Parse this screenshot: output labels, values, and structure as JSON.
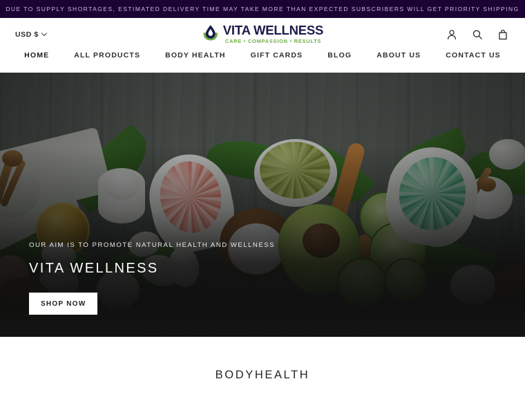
{
  "announcement": {
    "text": "DUE TO SUPPLY SHORTAGES, ESTIMATED DELIVERY TIME MAY TAKE MORE THAN EXPECTED SUBSCRIBERS WILL GET PRIORITY SHIPPING",
    "background_color": "#1b0434",
    "text_color": "#cdb8de"
  },
  "header": {
    "currency": {
      "label": "USD $",
      "options": [
        "USD $"
      ]
    },
    "logo": {
      "name": "VITA WELLNESS",
      "tagline": "CARE • COMPASSION • RESULTS",
      "name_color": "#1b1b4b",
      "tagline_color": "#6fae45",
      "mark": "water-drop-leaf-icon"
    },
    "actions": [
      {
        "name": "account",
        "icon": "user-icon"
      },
      {
        "name": "search",
        "icon": "search-icon"
      },
      {
        "name": "cart",
        "icon": "shopping-bag-icon"
      }
    ]
  },
  "nav": {
    "items": [
      {
        "label": "HOME",
        "active": true
      },
      {
        "label": "ALL PRODUCTS",
        "active": false
      },
      {
        "label": "BODY HEALTH",
        "active": false
      },
      {
        "label": "GIFT CARDS",
        "active": false
      },
      {
        "label": "BLOG",
        "active": false
      },
      {
        "label": "ABOUT US",
        "active": false
      },
      {
        "label": "CONTACT US",
        "active": false
      }
    ]
  },
  "hero": {
    "eyebrow": "OUR AIM IS TO PROMOTE NATURAL HEALTH AND WELLNESS",
    "title": "VITA WELLNESS",
    "cta_label": "SHOP NOW",
    "image_description": "Spa flat lay on dark wooden board with towels, jute rope, oil jar, cream jar, pink bath salt in ceramic spoon, green clay powder, avocado, cucumber slices, green bath salt in ceramic spoon, coconut, cotton bolls, stones and fern leaves"
  },
  "collection": {
    "title": "BODYHEALTH"
  }
}
